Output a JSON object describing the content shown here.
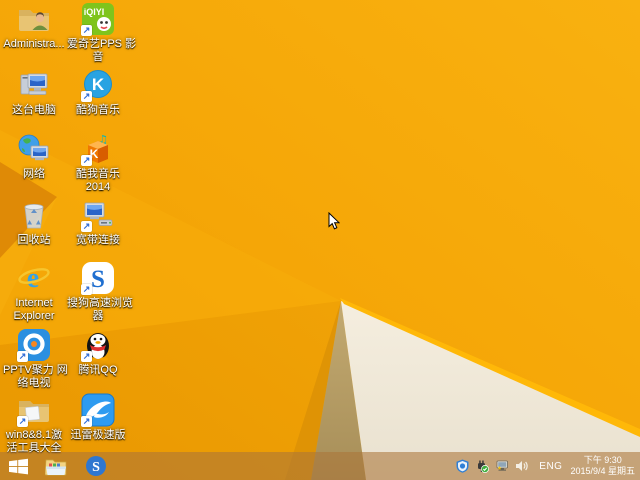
{
  "meta": {
    "os": "Windows 8.1 desktop",
    "language_indicator": "ENG"
  },
  "colors": {
    "wallpaper_top": "#F9B110",
    "wallpaper_bottom": "#EE9B02",
    "left_wedge": "#DF8A06",
    "dart_tan": "#B69C63",
    "dart_cream": "#F2EBDB",
    "dart_ridge": "#FFB808",
    "taskbar": "#B98B52"
  },
  "desktop": {
    "icons": [
      {
        "name": "administrator-folder",
        "line1": "Administra..."
      },
      {
        "name": "iqiyi-pps",
        "line1": "爱奇艺PPS 影",
        "line2": "音"
      },
      {
        "name": "this-pc",
        "line1": "这台电脑"
      },
      {
        "name": "kugou-music",
        "line1": "酷狗音乐"
      },
      {
        "name": "network",
        "line1": "网络"
      },
      {
        "name": "kuwo-music",
        "line1": "酷我音乐",
        "line2": "2014"
      },
      {
        "name": "recycle-bin",
        "line1": "回收站"
      },
      {
        "name": "broadband-connection",
        "line1": "宽带连接"
      },
      {
        "name": "internet-explorer",
        "line1": "Internet",
        "line2": "Explorer"
      },
      {
        "name": "sogou-browser",
        "line1": "搜狗高速浏览",
        "line2": "器"
      },
      {
        "name": "pptv",
        "line1": "PPTV聚力 网",
        "line2": "络电视"
      },
      {
        "name": "tencent-qq",
        "line1": "腾讯QQ"
      },
      {
        "name": "win8-activation-tools",
        "line1": "win8&8.1激",
        "line2": "活工具大全"
      },
      {
        "name": "xunlei-thunder",
        "line1": "迅雷极速版"
      }
    ]
  },
  "taskbar": {
    "buttons": [
      "start",
      "file-explorer",
      "sogou-browser"
    ],
    "tray_icons": [
      "security-shield",
      "power-plug-ok",
      "network-status-warning",
      "speaker-volume"
    ],
    "language": "ENG",
    "clock": {
      "time": "下午 9:30",
      "date": "2015/9/4 星期五"
    }
  }
}
